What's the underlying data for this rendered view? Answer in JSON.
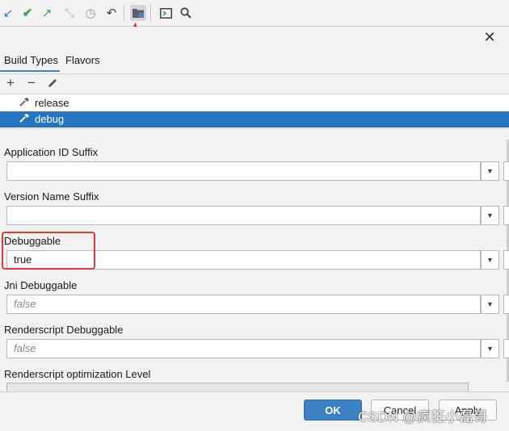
{
  "toolbar": {
    "icons": [
      "arrow-down-left-icon",
      "check-icon",
      "arrow-up-right-icon",
      "collapse-icon",
      "history-icon",
      "undo-icon",
      "project-structure-icon",
      "terminal-icon",
      "search-icon"
    ]
  },
  "dialog": {
    "close_glyph": "✕",
    "tabs": [
      "Build Types",
      "Flavors"
    ],
    "active_tab": "Build Types",
    "list_actions": [
      "+",
      "−"
    ],
    "build_types": [
      {
        "label": "release",
        "selected": false
      },
      {
        "label": "debug",
        "selected": true
      }
    ],
    "fields": [
      {
        "label": "Application ID Suffix",
        "value": "",
        "placeholder": false
      },
      {
        "label": "Version Name Suffix",
        "value": "",
        "placeholder": false
      },
      {
        "label": "Debuggable",
        "value": "true",
        "placeholder": false
      },
      {
        "label": "Jni Debuggable",
        "value": "false",
        "placeholder": true
      },
      {
        "label": "Renderscript Debuggable",
        "value": "false",
        "placeholder": true
      },
      {
        "label": "Renderscript optimization Level",
        "value": "",
        "placeholder": false
      }
    ],
    "buttons": {
      "ok": "OK",
      "cancel": "Cancel",
      "apply": "Apply"
    }
  },
  "watermark": "CSDN @疯狂小磊哥",
  "colors": {
    "accent": "#2675bf",
    "ok_button": "#3b82c4",
    "highlight": "#e23a3a"
  }
}
